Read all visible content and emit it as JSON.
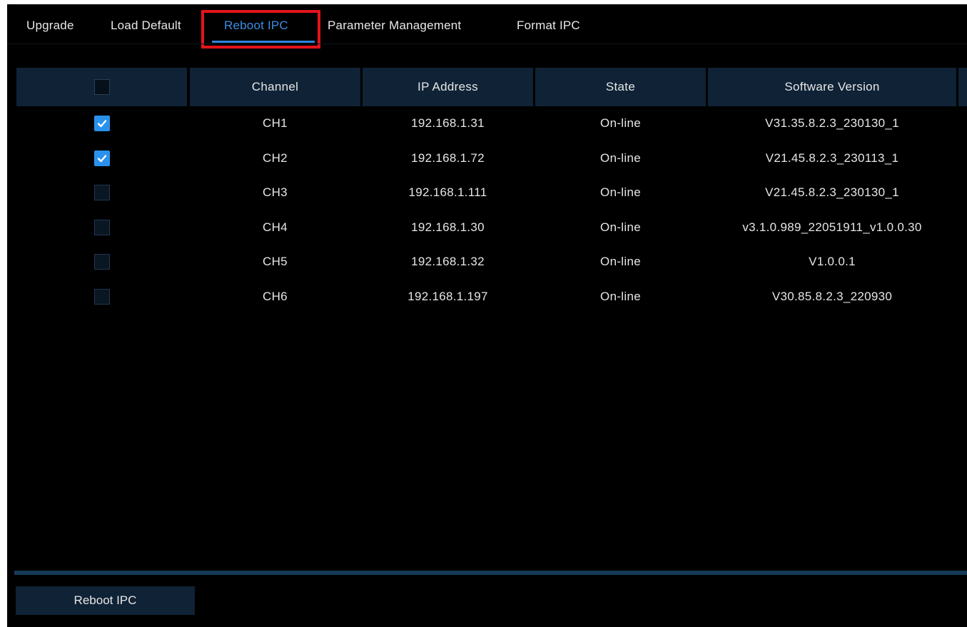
{
  "tabs": [
    {
      "label": "Upgrade",
      "active": false
    },
    {
      "label": "Load Default",
      "active": false
    },
    {
      "label": "Reboot IPC",
      "active": true
    },
    {
      "label": "Parameter Management",
      "active": false
    },
    {
      "label": "Format IPC",
      "active": false
    }
  ],
  "table": {
    "headers": [
      "",
      "Channel",
      "IP Address",
      "State",
      "Software Version"
    ],
    "header_checked": false,
    "rows": [
      {
        "checked": true,
        "channel": "CH1",
        "ip": "192.168.1.31",
        "state": "On-line",
        "version": "V31.35.8.2.3_230130_1"
      },
      {
        "checked": true,
        "channel": "CH2",
        "ip": "192.168.1.72",
        "state": "On-line",
        "version": "V21.45.8.2.3_230113_1"
      },
      {
        "checked": false,
        "channel": "CH3",
        "ip": "192.168.1.111",
        "state": "On-line",
        "version": "V21.45.8.2.3_230130_1"
      },
      {
        "checked": false,
        "channel": "CH4",
        "ip": "192.168.1.30",
        "state": "On-line",
        "version": "v3.1.0.989_22051911_v1.0.0.30"
      },
      {
        "checked": false,
        "channel": "CH5",
        "ip": "192.168.1.32",
        "state": "On-line",
        "version": "V1.0.0.1"
      },
      {
        "checked": false,
        "channel": "CH6",
        "ip": "192.168.1.197",
        "state": "On-line",
        "version": "V30.85.8.2.3_220930"
      }
    ]
  },
  "actions": {
    "reboot_label": "Reboot IPC"
  },
  "colors": {
    "accent": "#2a92ec",
    "highlight": "#e3141b",
    "header_bg": "#0f2236",
    "background": "#000000"
  },
  "icons": {
    "checkbox_checked": "check-icon"
  }
}
